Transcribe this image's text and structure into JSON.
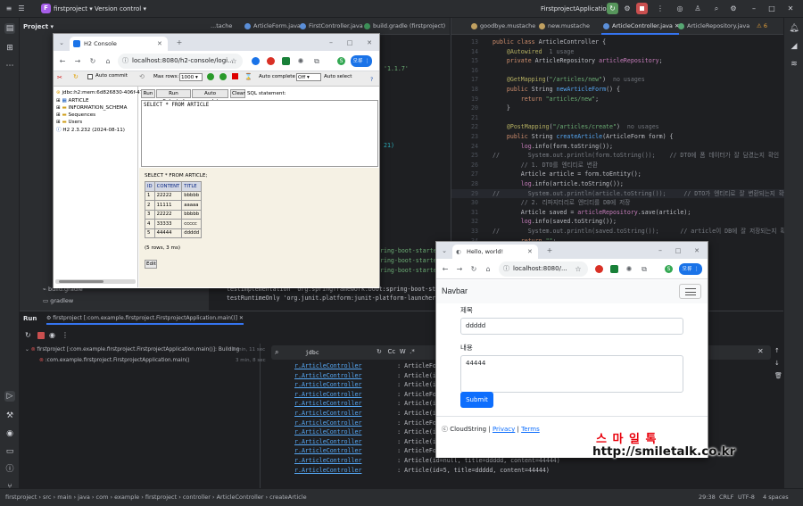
{
  "ide": {
    "project_name": "firstproject",
    "project_badge": "F",
    "version_control": "Version control",
    "run_config": "FirstprojectApplication",
    "project_panel_title": "Project",
    "tree_items": [
      "build.gradle",
      "gradlew"
    ],
    "left_tabs": [
      "...tache",
      "ArticleForm.java",
      "FirstController.java",
      "build.gradle (firstproject)"
    ],
    "right_tabs": [
      "goodbye.mustache",
      "new.mustache",
      "ArticleController.java",
      "ArticleRepository.java"
    ],
    "warn_count": "6",
    "left_code_lines": [
      {
        "text": "'1.1.7'",
        "top": 0
      },
      {
        "text": "21)",
        "top": 1
      }
    ],
    "gradle_lines": [
      "ring-boot-starter",
      "ring-boot-starter",
      "ring-boot-starter",
      "testImplementation 'org.springframework.boot:spring-boot-sta",
      "testRuntimeOnly 'org.junit.platform:junit-platform-launcher'"
    ],
    "code_start_line": 13,
    "code": [
      {
        "n": "13",
        "html": "<span class='kw'>public class</span> ArticleController {"
      },
      {
        "n": "14",
        "html": "    <span class='ann'>@Autowired</span>  <span class='gr'>1 usage</span>"
      },
      {
        "n": "15",
        "html": "    <span class='kw'>private</span> ArticleRepository <span class='fld'>articleRepository</span>;"
      },
      {
        "n": "16",
        "html": ""
      },
      {
        "n": "17",
        "html": "    <span class='ann'>@GetMapping</span>(<span class='str'>\"/articles/new\"</span>)  <span class='gr'>no usages</span>"
      },
      {
        "n": "18",
        "html": "    <span class='kw'>public</span> String <span class='fn'>newArticleForm</span>() {"
      },
      {
        "n": "19",
        "html": "        <span class='kw'>return</span> <span class='str'>\"articles/new\"</span>;"
      },
      {
        "n": "20",
        "html": "    }"
      },
      {
        "n": "21",
        "html": ""
      },
      {
        "n": "22",
        "html": "    <span class='ann'>@PostMapping</span>(<span class='str'>\"/articles/create\"</span>)  <span class='gr'>no usages</span>"
      },
      {
        "n": "23",
        "html": "    <span class='kw'>public</span> String <span class='fn'>createArticle</span>(ArticleForm form) {"
      },
      {
        "n": "24",
        "html": "        <span class='fld'>log</span>.info(form.toString());"
      },
      {
        "n": "25",
        "html": "<span class='cm'>//        System.out.println(form.toString());    // DTO에 폼 데이터가 잘 담겼는지 확인</span>"
      },
      {
        "n": "26",
        "html": "        <span class='cm'>// 1. DTO를 엔티티로 변환</span>"
      },
      {
        "n": "27",
        "html": "        Article article = form.toEntity();"
      },
      {
        "n": "28",
        "html": "        <span class='fld'>log</span>.info(article.toString());"
      },
      {
        "n": "29",
        "html": "<span class='cm'>//        System.out.println(article.toString());     // DTO가 엔티티로 잘 변환되는지 확</span>"
      },
      {
        "n": "30",
        "html": "        <span class='cm'>// 2. 리파지터리로 엔티티를 DB에 저장</span>"
      },
      {
        "n": "31",
        "html": "        Article saved = <span class='fld'>articleRepository</span>.save(article);"
      },
      {
        "n": "32",
        "html": "        <span class='fld'>log</span>.info(saved.toString());"
      },
      {
        "n": "33",
        "html": "<span class='cm'>//        System.out.println(saved.toString());      // article이 DB에 잘 저장되는지 확</span>"
      },
      {
        "n": "34",
        "html": "        <span class='kw'>return</span> <span class='str'>\"\"</span>;"
      }
    ],
    "run_tab": "Run",
    "run_config_tab": "firstproject [:com.example.firstproject.FirstprojectApplication.main()]",
    "run_tree": [
      {
        "label": "firstproject [:com.example.firstproject.FirstprojectApplication.main()]:",
        "status": "Building",
        "time": "3 min, 11 sec"
      },
      {
        "label": ":com.example.firstproject.FirstprojectApplication.main()",
        "status": "",
        "time": "3 min, 8 sec"
      }
    ],
    "console_search": "jdbc",
    "console_lines": [
      {
        "cls": "r.ArticleController",
        "msg": ": ArticleForm(title="
      },
      {
        "cls": "r.ArticleController",
        "msg": ": Article(id=null, title"
      },
      {
        "cls": "r.ArticleController",
        "msg": ": Article(id=2, title"
      },
      {
        "cls": "r.ArticleController",
        "msg": ": ArticleForm(title="
      },
      {
        "cls": "r.ArticleController",
        "msg": ": Article(id=null, ti"
      },
      {
        "cls": "r.ArticleController",
        "msg": ": Article(id=3, title"
      },
      {
        "cls": "r.ArticleController",
        "msg": ": ArticleForm(title="
      },
      {
        "cls": "r.ArticleController",
        "msg": ": Article(id=null, tit"
      },
      {
        "cls": "r.ArticleController",
        "msg": ": Article(id=4, title"
      },
      {
        "cls": "r.ArticleController",
        "msg": ": ArticleForm(title="
      },
      {
        "cls": "r.ArticleController",
        "msg": ": Article(id=null, title=ddddd, content=44444)"
      },
      {
        "cls": "r.ArticleController",
        "msg": ": Article(id=5, title=ddddd, content=44444)"
      }
    ],
    "status": {
      "breadcrumb": [
        "firstproject",
        "src",
        "main",
        "java",
        "com",
        "example",
        "firstproject",
        "controller",
        "ArticleController",
        "createArticle"
      ],
      "position": "29:38",
      "line_sep": "CRLF",
      "encoding": "UTF-8",
      "indent": "4 spaces"
    }
  },
  "h2": {
    "tab_title": "H2 Console",
    "url": "localhost:8080/h2-console/logi...",
    "auto_commit": "Auto commit",
    "max_label": "Max rows:",
    "max_rows": "1000",
    "auto_complete_label": "Auto complete",
    "auto_complete_value": "Off",
    "auto_select": "Auto select",
    "buttons": [
      "Run",
      "Run Selected",
      "Auto complete",
      "Clear"
    ],
    "sql_label": "SQL statement:",
    "sql_text": "SELECT * FROM ARTICLE",
    "tree": [
      "jdbc:h2:mem:6d826830-406f-478",
      "ARTICLE",
      "INFORMATION_SCHEMA",
      "Sequences",
      "Users",
      "H2 2.3.232 (2024-08-11)"
    ],
    "result_query": "SELECT * FROM ARTICLE;",
    "columns": [
      "ID",
      "CONTENT",
      "TITLE"
    ],
    "rows": [
      [
        "1",
        "22222",
        "bbbbb"
      ],
      [
        "2",
        "11111",
        "aaaaa"
      ],
      [
        "3",
        "22222",
        "bbbbb"
      ],
      [
        "4",
        "33333",
        "ccccc"
      ],
      [
        "5",
        "44444",
        "ddddd"
      ]
    ],
    "row_count": "(5 rows, 3 ms)",
    "edit_btn": "Edit"
  },
  "app": {
    "tab_title": "Hello, world!",
    "url": "localhost:8080/...",
    "brand": "Navbar",
    "title_label": "제목",
    "title_value": "ddddd",
    "content_label": "내용",
    "content_value": "44444",
    "submit": "Submit",
    "footer_copy": "ⓒ CloudString",
    "privacy": "Privacy",
    "terms": "Terms"
  },
  "watermark": {
    "line1": "스 마 일 톡",
    "line2": "http://smiletalk.co.kr"
  },
  "colors": {
    "accent": "#3574f0",
    "bootstrap_primary": "#0d6efd",
    "watermark_red": "#e8000b"
  }
}
